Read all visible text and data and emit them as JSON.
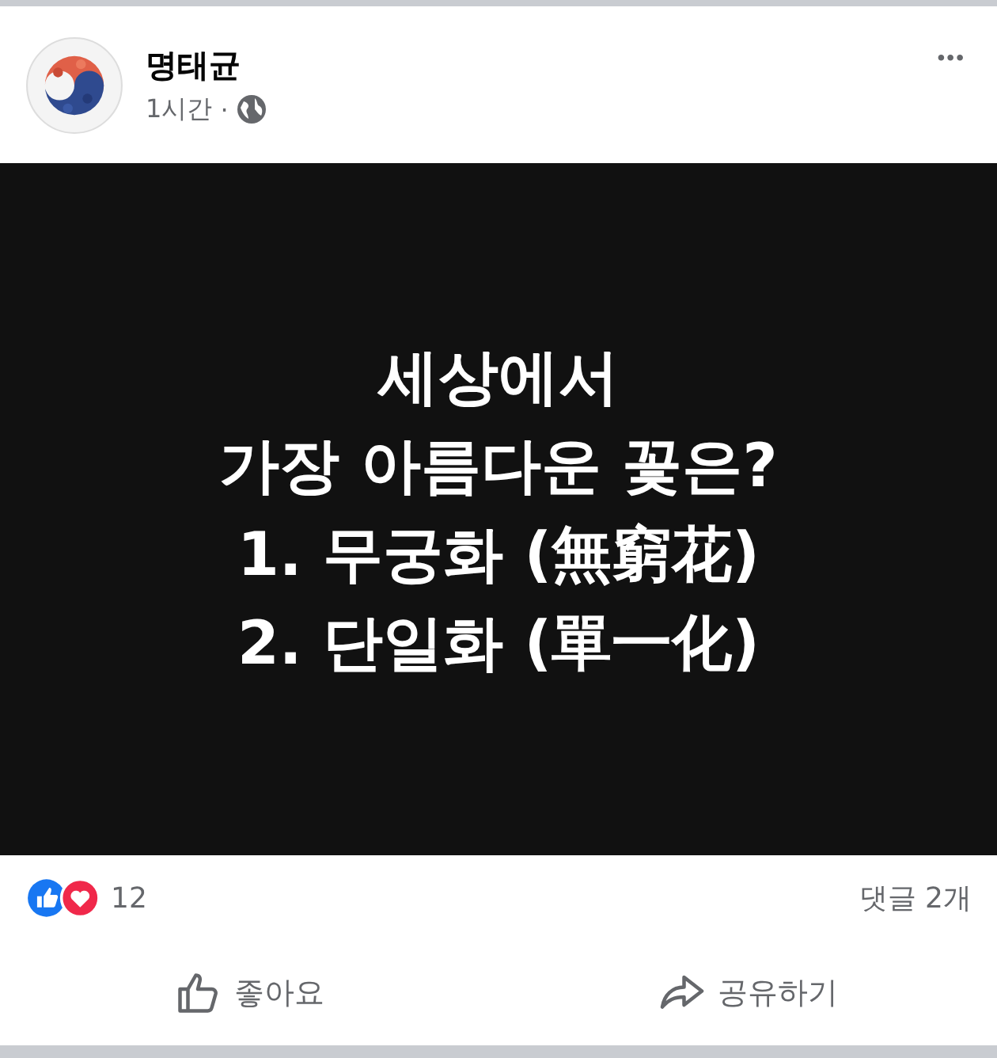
{
  "post": {
    "author": "명태균",
    "time": "1시간",
    "separator": "·",
    "menu": "•••"
  },
  "image": {
    "lines": [
      "세상에서",
      "가장 아름다운 꽃은?",
      "1. 무궁화 (無窮花)",
      "2. 단일화 (單一化)"
    ]
  },
  "reactions": {
    "count": "12",
    "comments": "댓글 2개"
  },
  "actions": [
    {
      "kind": "like",
      "label": "좋아요"
    },
    {
      "kind": "share",
      "label": "공유하기"
    }
  ]
}
